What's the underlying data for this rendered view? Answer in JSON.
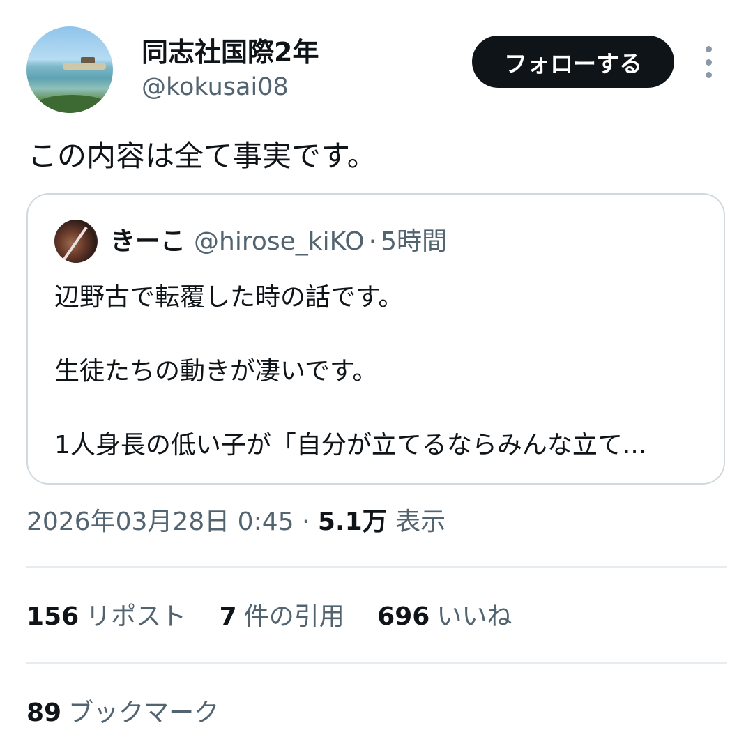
{
  "author": {
    "name": "同志社国際2年",
    "handle": "@kokusai08",
    "follow_label": "フォローする"
  },
  "tweet": {
    "text": "この内容は全て事実です。"
  },
  "quoted": {
    "name": "きーこ",
    "handle": "@hirose_kiKO",
    "separator": "·",
    "time": "5時間",
    "lines": [
      "辺野古で転覆した時の話です。",
      "生徒たちの動きが凄いです。",
      "1人身長の低い子が「自分が立てるならみんな立て..."
    ]
  },
  "meta": {
    "datetime": "2026年03月28日 0:45",
    "separator": "·",
    "views_count": "5.1万",
    "views_label": "表示"
  },
  "stats": {
    "reposts": {
      "count": "156",
      "label": "リポスト"
    },
    "quotes": {
      "count": "7",
      "label": "件の引用"
    },
    "likes": {
      "count": "696",
      "label": "いいね"
    },
    "bookmarks": {
      "count": "89",
      "label": "ブックマーク"
    }
  },
  "icons": {
    "more": "more-vertical-icon"
  },
  "colors": {
    "text": "#0f1419",
    "secondary": "#536471",
    "button_bg": "#0f1419",
    "border": "#cfd9de"
  }
}
